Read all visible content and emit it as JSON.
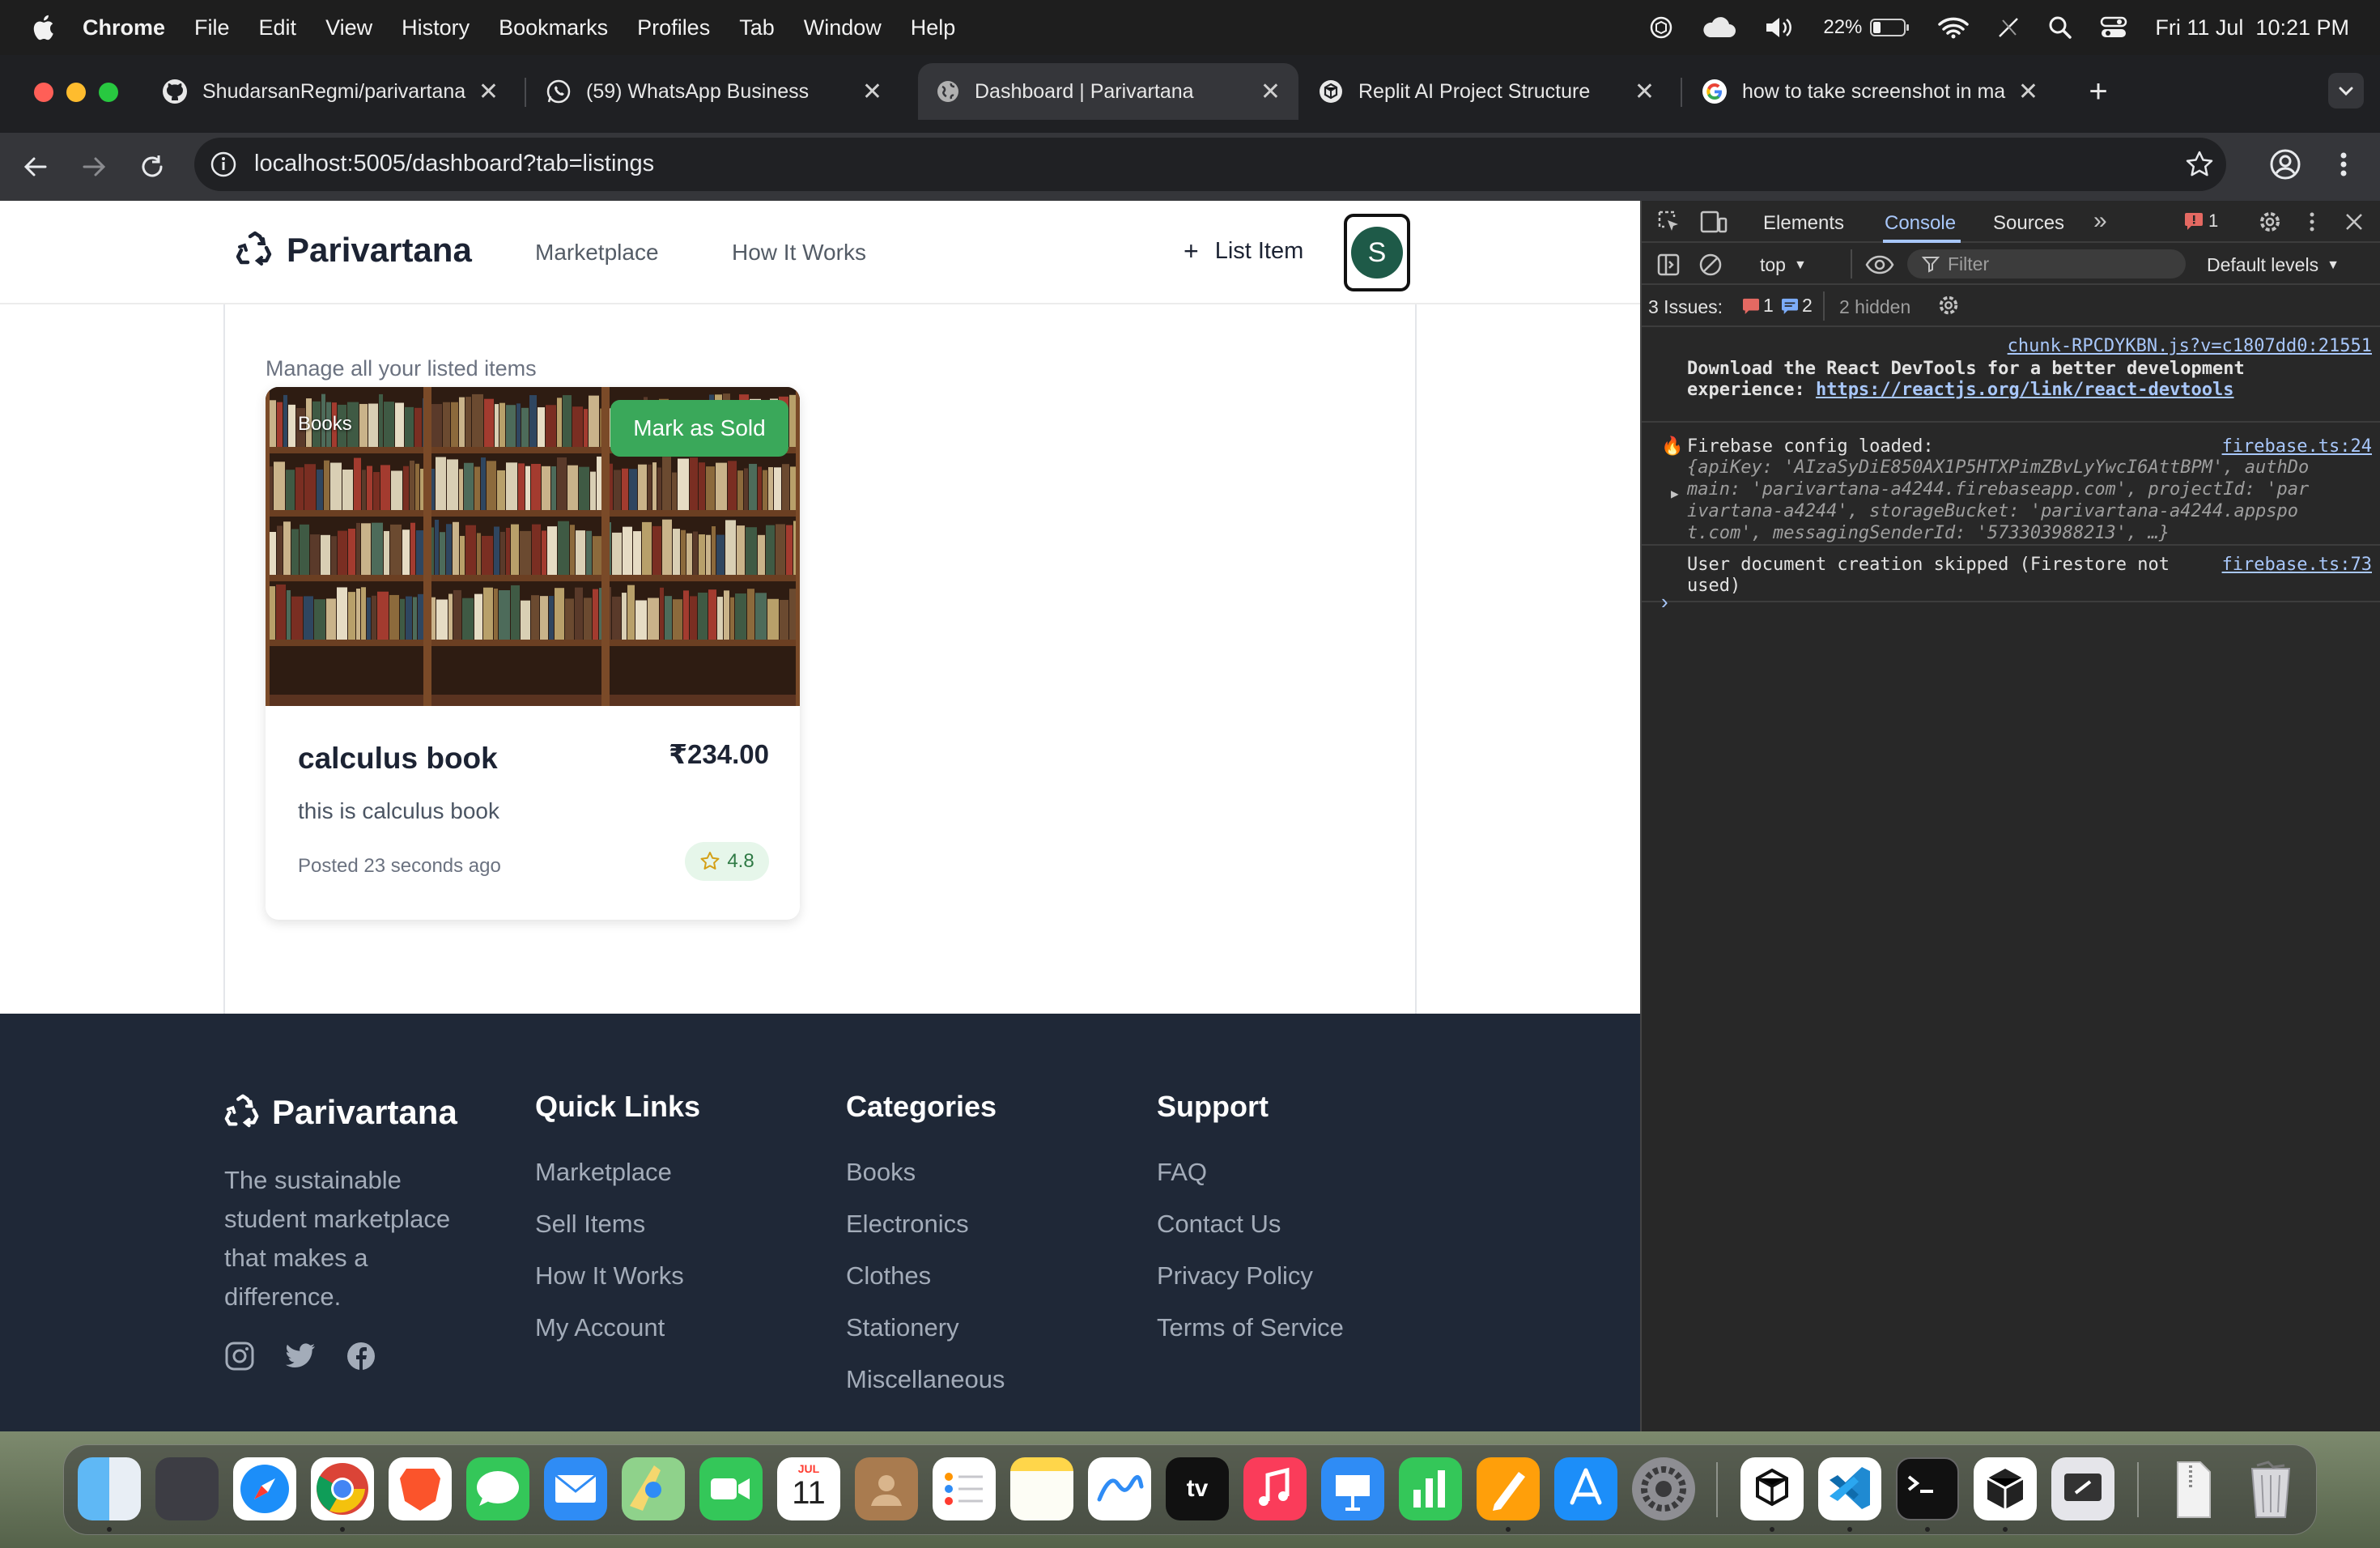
{
  "menubar": {
    "app": "Chrome",
    "items": [
      "File",
      "Edit",
      "View",
      "History",
      "Bookmarks",
      "Profiles",
      "Tab",
      "Window",
      "Help"
    ],
    "battery": "22%",
    "datetime": "Fri 11 Jul  10:21 PM"
  },
  "tabs": [
    {
      "title": "ShudarsanRegmi/parivartana",
      "icon": "github-icon"
    },
    {
      "title": "(59) WhatsApp Business",
      "icon": "whatsapp-icon"
    },
    {
      "title": "Dashboard | Parivartana",
      "icon": "globe-icon"
    },
    {
      "title": "Replit AI Project Structure",
      "icon": "openai-icon"
    },
    {
      "title": "how to take screenshot in ma",
      "icon": "google-icon"
    }
  ],
  "address": {
    "url": "localhost:5005/dashboard?tab=listings"
  },
  "site": {
    "logo": "Parivartana",
    "nav": [
      "Marketplace",
      "How It Works"
    ],
    "list_item": "List Item",
    "avatar_initial": "S"
  },
  "dashboard": {
    "subtitle": "Manage all your listed items"
  },
  "listing": {
    "category": "Books",
    "mark_sold": "Mark as Sold",
    "title": "calculus book",
    "price": "₹234.00",
    "description": "this is calculus book",
    "posted": "Posted 23 seconds ago",
    "rating": "4.8"
  },
  "footer": {
    "logo": "Parivartana",
    "tagline_lines": [
      "The sustainable",
      "student marketplace",
      "that makes a",
      "difference."
    ],
    "quick_links": {
      "title": "Quick Links",
      "items": [
        "Marketplace",
        "Sell Items",
        "How It Works",
        "My Account"
      ]
    },
    "categories": {
      "title": "Categories",
      "items": [
        "Books",
        "Electronics",
        "Clothes",
        "Stationery",
        "Miscellaneous"
      ]
    },
    "support": {
      "title": "Support",
      "items": [
        "FAQ",
        "Contact Us",
        "Privacy Policy",
        "Terms of Service"
      ]
    }
  },
  "devtools": {
    "tabs": [
      "Elements",
      "Console",
      "Sources"
    ],
    "error_badge": "1",
    "context": "top",
    "filter_placeholder": "Filter",
    "levels": "Default levels",
    "issues_label": "3 Issues:",
    "issues_errors": "1",
    "issues_info": "2",
    "issues_hidden": "2 hidden",
    "log1_source": "chunk-RPCDYKBN.js?v=c1807dd0:21551",
    "log1_line1": "Download the React DevTools for a better development",
    "log1_line2_prefix": "experience: ",
    "log1_link": "https://reactjs.org/link/react-devtools",
    "log2_emoji": "🔥",
    "log2_text": "Firebase config loaded:",
    "log2_source": "firebase.ts:24",
    "log2_obj_lines": [
      "{apiKey: 'AIzaSyDiE850AX1P5HTXPimZBvLyYwcI6AttBPM', authDo",
      "main: 'parivartana-a4244.firebaseapp.com', projectId: 'par",
      "ivartana-a4244', storageBucket: 'parivartana-a4244.appspo",
      "t.com', messagingSenderId: '573303988213', …}"
    ],
    "log3_line1": "User document creation skipped (Firestore not",
    "log3_line2": "used)",
    "log3_source": "firebase.ts:73"
  },
  "dock": {
    "calendar_month": "JUL",
    "calendar_day": "11",
    "tv_label": "tv"
  }
}
